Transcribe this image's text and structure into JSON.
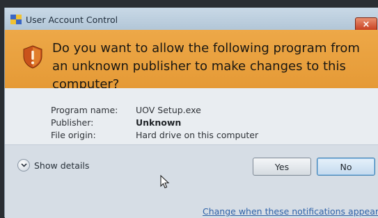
{
  "window": {
    "title": "User Account Control",
    "close_label": "×"
  },
  "banner": {
    "question": "Do you want to allow the following program from an unknown publisher to make changes to this computer?"
  },
  "details": {
    "program_name_label": "Program name:",
    "program_name_value": "UOV Setup.exe",
    "publisher_label": "Publisher:",
    "publisher_value": "Unknown",
    "file_origin_label": "File origin:",
    "file_origin_value": "Hard drive on this computer"
  },
  "footer": {
    "show_details_label": "Show details",
    "yes_label": "Yes",
    "no_label": "No",
    "notifications_link": "Change when these notifications appear"
  },
  "icons": {
    "title": "uac-shield-icon",
    "banner": "warning-shield-icon",
    "toggle": "chevron-down-icon",
    "cursor": "mouse-pointer-icon"
  },
  "colors": {
    "banner": "#e59a36",
    "close_button": "#c63c1e",
    "link": "#2e62a8",
    "no_button_accent": "#3c7fb1"
  }
}
